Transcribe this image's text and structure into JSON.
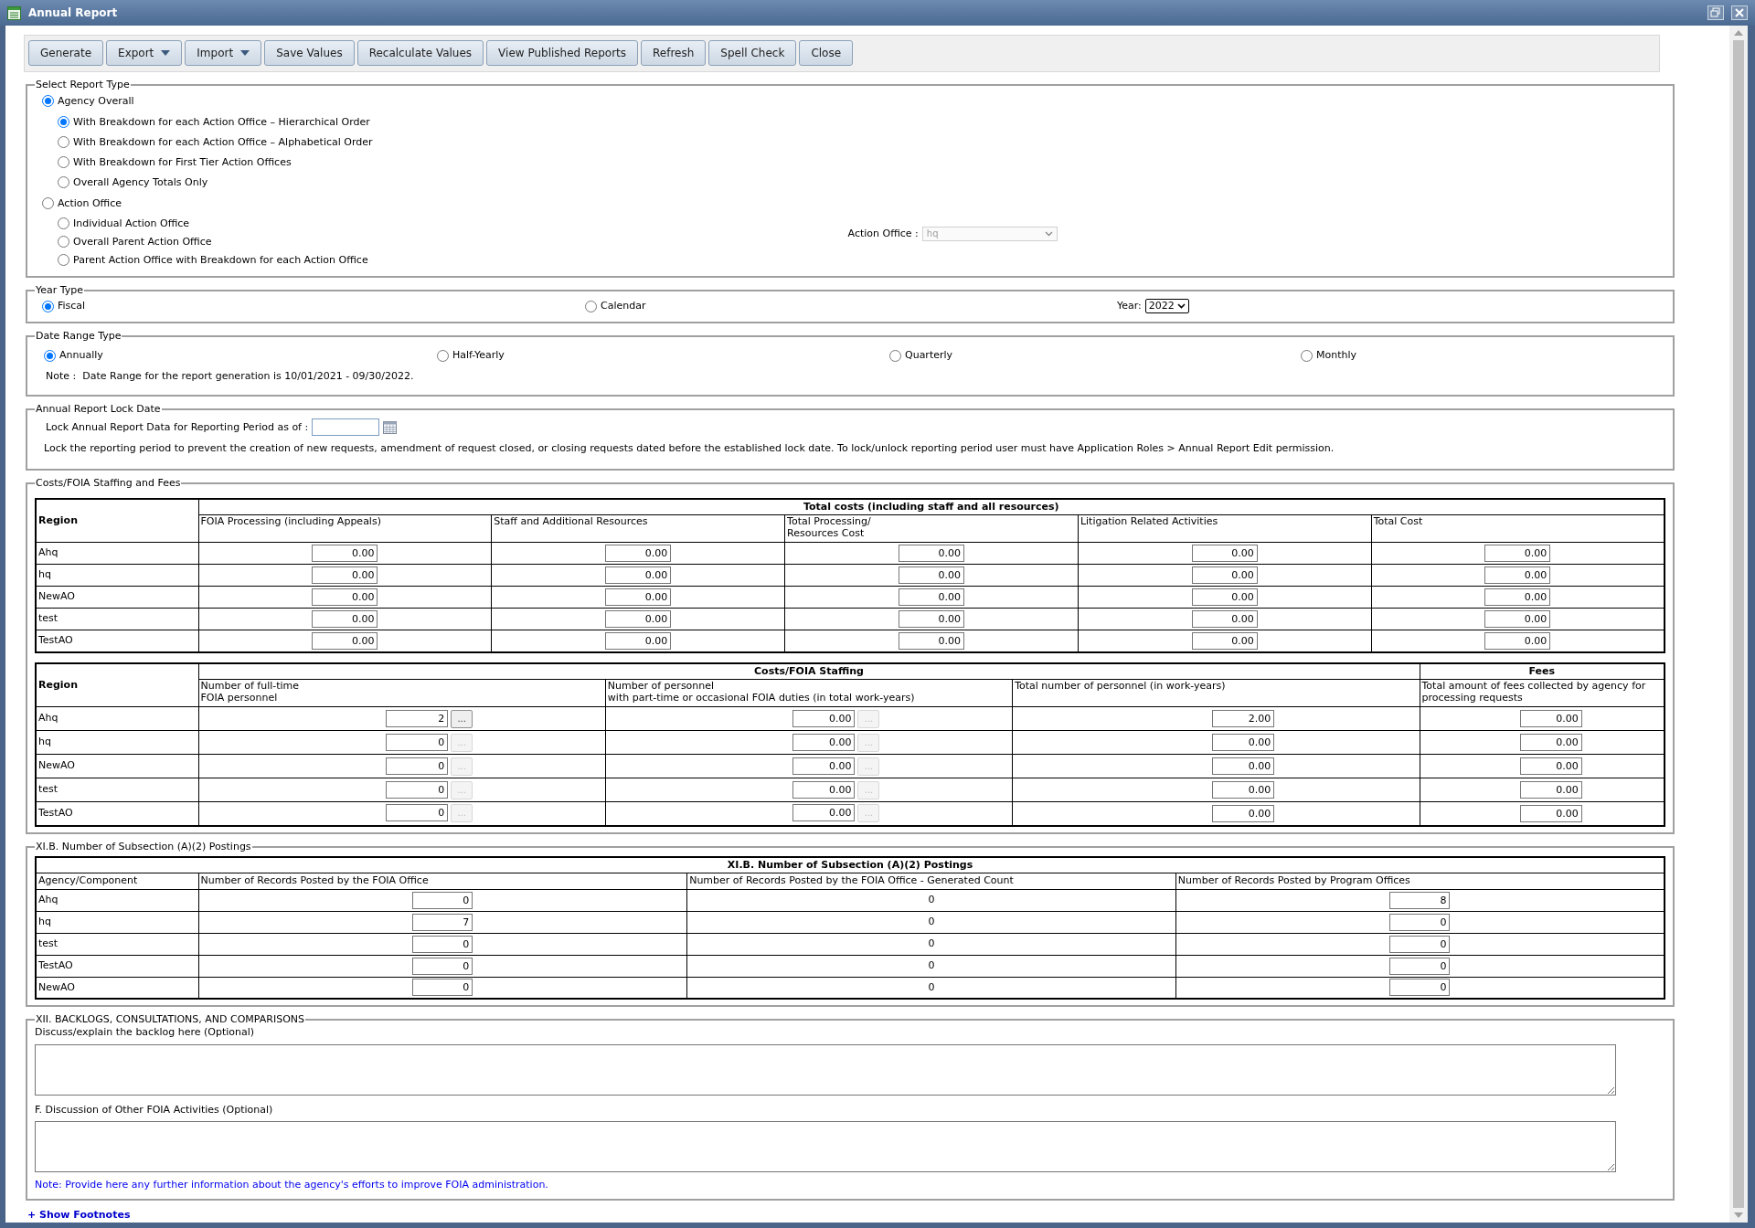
{
  "window": {
    "title": "Annual Report"
  },
  "toolbar": [
    {
      "label": "Generate",
      "dropdown": false
    },
    {
      "label": "Export",
      "dropdown": true
    },
    {
      "label": "Import",
      "dropdown": true
    },
    {
      "label": "Save Values",
      "dropdown": false
    },
    {
      "label": "Recalculate Values",
      "dropdown": false
    },
    {
      "label": "View Published Reports",
      "dropdown": false
    },
    {
      "label": "Refresh",
      "dropdown": false
    },
    {
      "label": "Spell Check",
      "dropdown": false
    },
    {
      "label": "Close",
      "dropdown": false
    }
  ],
  "report_type": {
    "legend": "Select Report Type",
    "groups": [
      {
        "label": "Agency Overall",
        "selected": true,
        "options": [
          {
            "label": "With Breakdown for each Action Office – Hierarchical Order",
            "selected": true
          },
          {
            "label": "With Breakdown for each Action Office – Alphabetical Order",
            "selected": false
          },
          {
            "label": "With Breakdown for First Tier Action Offices",
            "selected": false
          },
          {
            "label": "Overall Agency Totals Only",
            "selected": false
          }
        ]
      },
      {
        "label": "Action Office",
        "selected": false,
        "options": [
          {
            "label": "Individual Action Office",
            "selected": false
          },
          {
            "label": "Overall Parent Action Office",
            "selected": false
          },
          {
            "label": "Parent Action Office with Breakdown for each Action Office",
            "selected": false
          }
        ]
      }
    ],
    "action_office": {
      "label": "Action Office :",
      "value": "hq",
      "disabled": true
    }
  },
  "year_type": {
    "legend": "Year Type",
    "options": [
      {
        "label": "Fiscal",
        "selected": true
      },
      {
        "label": "Calendar",
        "selected": false
      }
    ],
    "year": {
      "label": "Year:",
      "value": "2022"
    }
  },
  "date_range": {
    "legend": "Date Range Type",
    "options": [
      {
        "label": "Annually",
        "selected": true
      },
      {
        "label": "Half-Yearly",
        "selected": false
      },
      {
        "label": "Quarterly",
        "selected": false
      },
      {
        "label": "Monthly",
        "selected": false
      }
    ],
    "note": "Note :  Date Range for the report generation is 10/01/2021 - 09/30/2022."
  },
  "lock": {
    "legend": "Annual Report Lock Date",
    "label": "Lock Annual Report Data for Reporting Period as of :",
    "note": "Lock the reporting period to prevent the creation of new requests, amendment of request closed, or closing requests dated before the established lock date. To lock/unlock reporting period user must have Application Roles > Annual Report Edit permission."
  },
  "costs": {
    "legend": "Costs/FOIA Staffing and Fees",
    "table1": {
      "region_header": "Region",
      "group_header": "Total costs (including staff and all resources)",
      "columns": [
        "FOIA Processing (including Appeals)",
        "Staff and Additional Resources",
        "Total Processing/\nResources Cost",
        "Litigation Related Activities",
        "Total Cost"
      ],
      "rows": [
        {
          "region": "Ahq",
          "values": [
            "0.00",
            "0.00",
            "0.00",
            "0.00",
            "0.00"
          ]
        },
        {
          "region": "hq",
          "values": [
            "0.00",
            "0.00",
            "0.00",
            "0.00",
            "0.00"
          ]
        },
        {
          "region": "NewAO",
          "values": [
            "0.00",
            "0.00",
            "0.00",
            "0.00",
            "0.00"
          ]
        },
        {
          "region": "test",
          "values": [
            "0.00",
            "0.00",
            "0.00",
            "0.00",
            "0.00"
          ]
        },
        {
          "region": "TestAO",
          "values": [
            "0.00",
            "0.00",
            "0.00",
            "0.00",
            "0.00"
          ]
        }
      ]
    },
    "table2": {
      "region_header": "Region",
      "staffing_header": "Costs/FOIA Staffing",
      "fees_header": "Fees",
      "columns": [
        "Number of full-time\nFOIA personnel",
        "Number of personnel\nwith part-time or occasional FOIA duties (in total work-years)",
        "Total number of personnel (in work-years)",
        "Total amount of fees collected by agency for processing requests"
      ],
      "rows": [
        {
          "region": "Ahq",
          "full_time": "2",
          "full_time_detail": {
            "label": "...",
            "disabled": false
          },
          "part_time": "0.00",
          "part_time_detail": {
            "label": "...",
            "disabled": true
          },
          "total": "2.00",
          "fees": "0.00"
        },
        {
          "region": "hq",
          "full_time": "0",
          "full_time_detail": {
            "label": "...",
            "disabled": true
          },
          "part_time": "0.00",
          "part_time_detail": {
            "label": "...",
            "disabled": true
          },
          "total": "0.00",
          "fees": "0.00"
        },
        {
          "region": "NewAO",
          "full_time": "0",
          "full_time_detail": {
            "label": "...",
            "disabled": true
          },
          "part_time": "0.00",
          "part_time_detail": {
            "label": "...",
            "disabled": true
          },
          "total": "0.00",
          "fees": "0.00"
        },
        {
          "region": "test",
          "full_time": "0",
          "full_time_detail": {
            "label": "...",
            "disabled": true
          },
          "part_time": "0.00",
          "part_time_detail": {
            "label": "...",
            "disabled": true
          },
          "total": "0.00",
          "fees": "0.00"
        },
        {
          "region": "TestAO",
          "full_time": "0",
          "full_time_detail": {
            "label": "...",
            "disabled": true
          },
          "part_time": "0.00",
          "part_time_detail": {
            "label": "...",
            "disabled": true
          },
          "total": "0.00",
          "fees": "0.00"
        }
      ]
    }
  },
  "postings": {
    "legend": "XI.B. Number of Subsection (A)(2) Postings",
    "title": "XI.B. Number of Subsection (A)(2) Postings",
    "columns": [
      "Agency/Component",
      "Number of Records Posted by the FOIA Office",
      "Number of Records Posted by the FOIA Office - Generated Count",
      "Number of Records Posted by Program Offices"
    ],
    "rows": [
      {
        "agency": "Ahq",
        "posted": "0",
        "generated": "0",
        "program": "8"
      },
      {
        "agency": "hq",
        "posted": "7",
        "generated": "0",
        "program": "0"
      },
      {
        "agency": "test",
        "posted": "0",
        "generated": "0",
        "program": "0"
      },
      {
        "agency": "TestAO",
        "posted": "0",
        "generated": "0",
        "program": "0"
      },
      {
        "agency": "NewAO",
        "posted": "0",
        "generated": "0",
        "program": "0"
      }
    ]
  },
  "backlogs": {
    "legend": "XII. BACKLOGS, CONSULTATIONS, AND COMPARISONS",
    "fields": [
      {
        "label": "Discuss/explain the backlog here (Optional)"
      },
      {
        "label": "F. Discussion of Other FOIA Activities (Optional)"
      }
    ],
    "note": "Note: Provide here any further information about the agency's efforts to improve FOIA administration."
  },
  "footnotes_link": "+ Show Footnotes"
}
